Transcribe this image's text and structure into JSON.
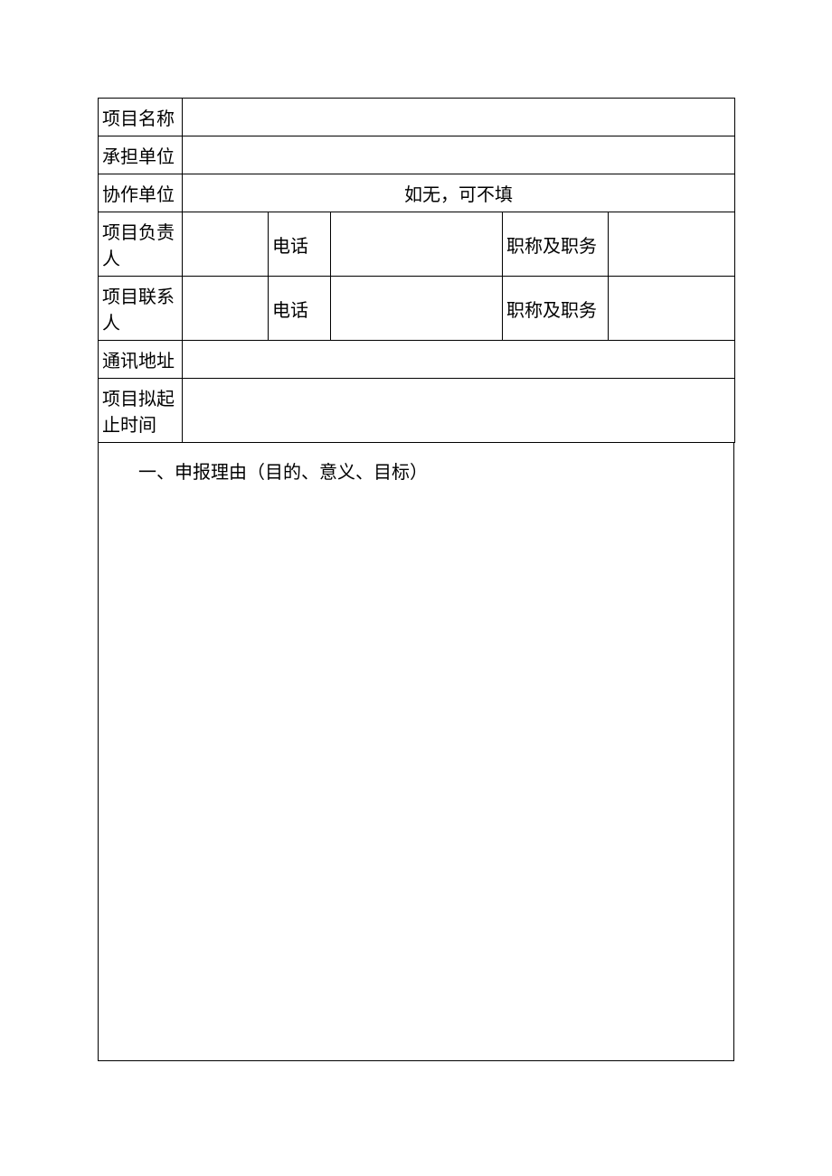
{
  "table": {
    "row1": {
      "label": "项目名称",
      "value": ""
    },
    "row2": {
      "label": "承担单位",
      "value": ""
    },
    "row3": {
      "label": "协作单位",
      "value": "如无，可不填"
    },
    "row4": {
      "label": "项目负责人",
      "name": "",
      "phone_label": "电话",
      "phone": "",
      "title_label": "职称及职务",
      "title": ""
    },
    "row5": {
      "label": "项目联系人",
      "name": "",
      "phone_label": "电话",
      "phone": "",
      "title_label": "职称及职务",
      "title": ""
    },
    "row6": {
      "label": "通讯地址",
      "value": ""
    },
    "row7": {
      "label": "项目拟起止时间",
      "value": ""
    }
  },
  "section1_title": "一、申报理由（目的、意义、目标）"
}
